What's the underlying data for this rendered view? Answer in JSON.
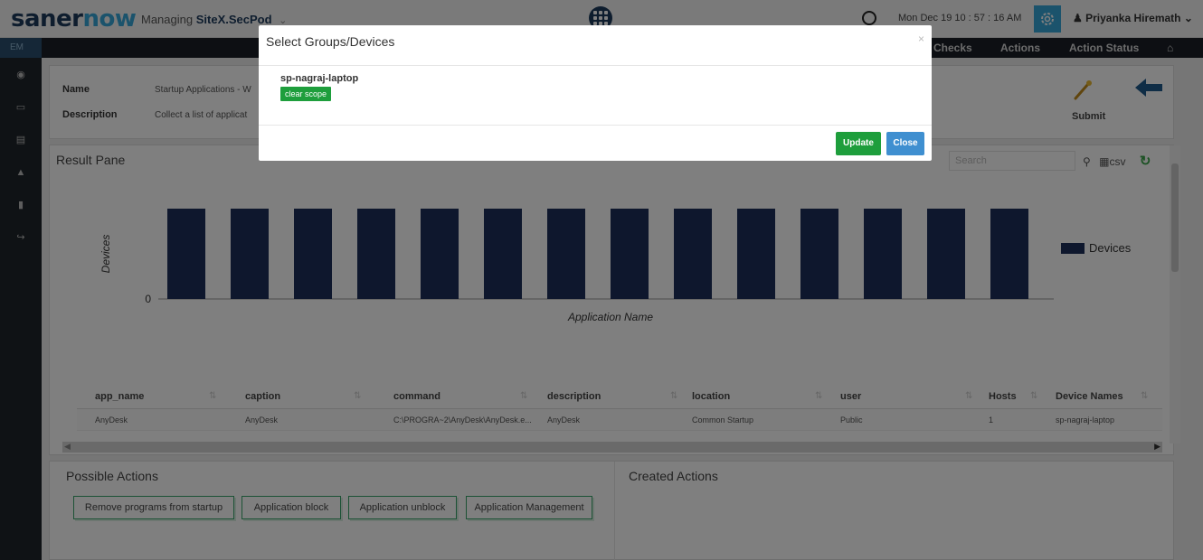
{
  "header": {
    "logo_part1": "saner",
    "logo_part2": "now",
    "managing_label": "Managing",
    "site_name": "SiteX.SecPod",
    "datetime": "Mon Dec 19  10 : 57 : 16 AM",
    "user_name": "Priyanka Hiremath"
  },
  "nav": {
    "module": "EM",
    "items": [
      "Checks",
      "Actions",
      "Action Status"
    ]
  },
  "info": {
    "name_label": "Name",
    "name_value": "Startup Applications - W",
    "description_label": "Description",
    "description_value": "Collect a list of applicat",
    "submit_label": "Submit"
  },
  "result_pane": {
    "title": "Result Pane",
    "search_placeholder": "Search",
    "csv_label": "csv"
  },
  "chart_data": {
    "type": "bar",
    "title": "",
    "xlabel": "Application Name",
    "ylabel": "Devices",
    "y_tick_labels": [
      "0"
    ],
    "bar_count": 14,
    "bar_value": 1,
    "series": [
      {
        "name": "Devices",
        "values": [
          1,
          1,
          1,
          1,
          1,
          1,
          1,
          1,
          1,
          1,
          1,
          1,
          1,
          1
        ]
      }
    ],
    "legend": "right",
    "bar_color": "#1c2e5a"
  },
  "table": {
    "columns": [
      "app_name",
      "caption",
      "command",
      "description",
      "location",
      "user",
      "Hosts",
      "Device Names"
    ],
    "rows": [
      [
        "AnyDesk",
        "AnyDesk",
        "C:\\PROGRA~2\\AnyDesk\\AnyDesk.e...",
        "AnyDesk",
        "Common Startup",
        "Public",
        "1",
        "sp-nagraj-laptop"
      ]
    ]
  },
  "possible_actions": {
    "title": "Possible Actions",
    "buttons": [
      "Remove programs from startup",
      "Application block",
      "Application unblock",
      "Application Management"
    ]
  },
  "created_actions": {
    "title": "Created Actions"
  },
  "modal": {
    "title": "Select Groups/Devices",
    "close_glyph": "×",
    "device": "sp-nagraj-laptop",
    "clear_scope": "clear scope",
    "update": "Update",
    "close": "Close"
  },
  "colors": {
    "accent_blue": "#36a7d9",
    "green": "#1e9e3c",
    "bar": "#1c2e5a"
  }
}
